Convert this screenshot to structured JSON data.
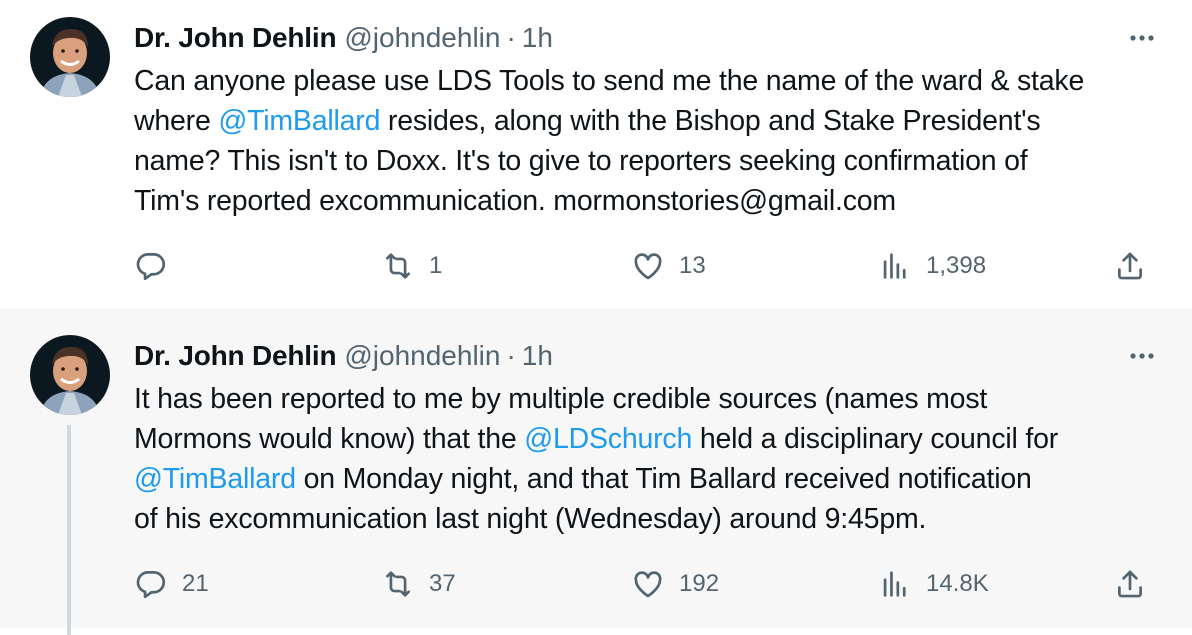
{
  "tweets": [
    {
      "author": {
        "display_name": "Dr. John Dehlin",
        "handle": "@johndehlin",
        "separator": "·",
        "time": "1h"
      },
      "lines": [
        {
          "before": "Can anyone please use LDS Tools to send me the name of the ward & stake",
          "mention": "",
          "after": ""
        },
        {
          "before": "where ",
          "mention": "@TimBallard",
          "after": "  resides, along with the Bishop and Stake President's"
        },
        {
          "before": "name?  This isn't to Doxx.  It's to give to reporters seeking confirmation of",
          "mention": "",
          "after": ""
        },
        {
          "before": "Tim's reported excommunication.  mormonstories@gmail.com",
          "mention": "",
          "after": ""
        }
      ],
      "stats": {
        "replies": "",
        "retweets": "1",
        "likes": "13",
        "views": "1,398"
      }
    },
    {
      "author": {
        "display_name": "Dr. John Dehlin",
        "handle": "@johndehlin",
        "separator": "·",
        "time": "1h"
      },
      "lines": [
        {
          "before": "It has been reported to me by multiple credible sources (names most",
          "mention": "",
          "after": ""
        },
        {
          "before": "Mormons would know) that the ",
          "mention": "@LDSchurch",
          "after": " held a disciplinary council for"
        },
        {
          "before": "",
          "mention": "@TimBallard",
          "after": " on Monday night, and that Tim Ballard received notification"
        },
        {
          "before": "of his excommunication last night (Wednesday) around 9:45pm.",
          "mention": "",
          "after": ""
        }
      ],
      "stats": {
        "replies": "21",
        "retweets": "37",
        "likes": "192",
        "views": "14.8K"
      }
    }
  ],
  "colors": {
    "text": "#0f1419",
    "secondary": "#536471",
    "link": "#1d9bf0",
    "thread_line": "#cfd9de",
    "highlight_bg": "#f7f7f7"
  },
  "icons": {
    "more": "more-horizontal-icon",
    "reply": "reply-icon",
    "retweet": "retweet-icon",
    "like": "heart-icon",
    "views": "views-chart-icon",
    "share": "share-icon"
  }
}
